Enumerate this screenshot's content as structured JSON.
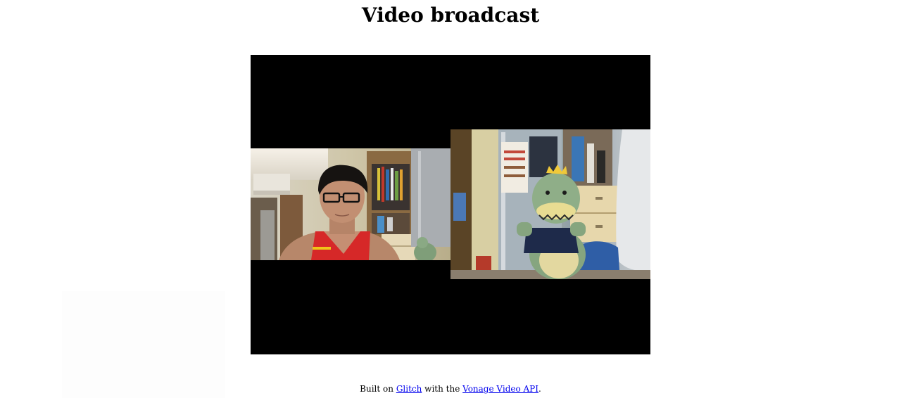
{
  "page": {
    "title": "Video broadcast"
  },
  "broadcast": {
    "feeds": [
      {
        "name": "publisher-feed",
        "subject": "person-with-glasses"
      },
      {
        "name": "subscriber-feed",
        "subject": "plush-dinosaur"
      }
    ]
  },
  "footer": {
    "prefix": "Built on ",
    "link1": "Glitch",
    "middle": " with the ",
    "link2": "Vonage Video API",
    "suffix": "."
  },
  "colors": {
    "link": "#0000ee",
    "stage_background": "#000000"
  }
}
